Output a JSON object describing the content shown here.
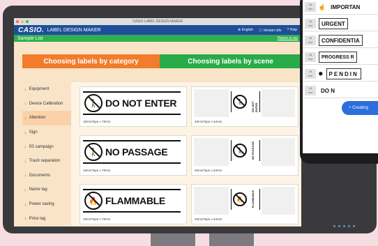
{
  "window": {
    "title": "CASIO LABEL DESIGN MAKER"
  },
  "header": {
    "logo": "CASIO.",
    "app_name": "LABEL DESIGN MAKER",
    "language": "English",
    "version": "Version info",
    "help": "Help"
  },
  "subheader": {
    "title": "Sample List",
    "return_link": "Return to top"
  },
  "tabs": [
    {
      "label": "Choosing labels by category"
    },
    {
      "label": "Choosing labels by scene"
    }
  ],
  "sidebar": {
    "items": [
      {
        "label": "Equipment"
      },
      {
        "label": "Device Calibration"
      },
      {
        "label": "Attention"
      },
      {
        "label": "Sign"
      },
      {
        "label": "5S campaign"
      },
      {
        "label": "Trash separation"
      },
      {
        "label": "Documents"
      },
      {
        "label": "Name tag"
      },
      {
        "label": "Power saving"
      },
      {
        "label": "Price tag"
      }
    ]
  },
  "cards": [
    {
      "sign": "DO NOT ENTER",
      "caption": "18mmTape x 78mm",
      "icon": "no-entry-person-icon"
    },
    {
      "sign": "DO NOT ENTER",
      "caption": "46mmTape x 54mm",
      "icon": "no-entry-person-icon"
    },
    {
      "sign": "NO PASSAGE",
      "caption": "18mmTape x 78mm",
      "icon": "no-passage-icon"
    },
    {
      "sign": "NO PASSAGE",
      "caption": "46mmTape x 54mm",
      "icon": "no-passage-icon"
    },
    {
      "sign": "FLAMMABLE",
      "caption": "18mmTape x 78mm",
      "icon": "no-fire-icon"
    },
    {
      "sign": "FLAMMABLE",
      "caption": "46mmTape x 54mm",
      "icon": "no-fire-icon"
    }
  ],
  "phone": {
    "rows": [
      {
        "size": "18",
        "unit": "mm",
        "label": "IMPORTAN"
      },
      {
        "size": "18",
        "unit": "mm",
        "label": "URGENT"
      },
      {
        "size": "18",
        "unit": "mm",
        "label": "CONFIDENTIA"
      },
      {
        "size": "18",
        "unit": "mm",
        "label": "PROGRESS R"
      },
      {
        "size": "18",
        "unit": "mm",
        "label": "PENDIN"
      },
      {
        "size": "18",
        "unit": "mm",
        "label": "DO N"
      }
    ],
    "fab_label": "+ Creating"
  },
  "colors": {
    "appbar": "#1f4e9a",
    "green": "#2fb04f",
    "orange": "#f17c2c",
    "background": "#f6dde2"
  }
}
